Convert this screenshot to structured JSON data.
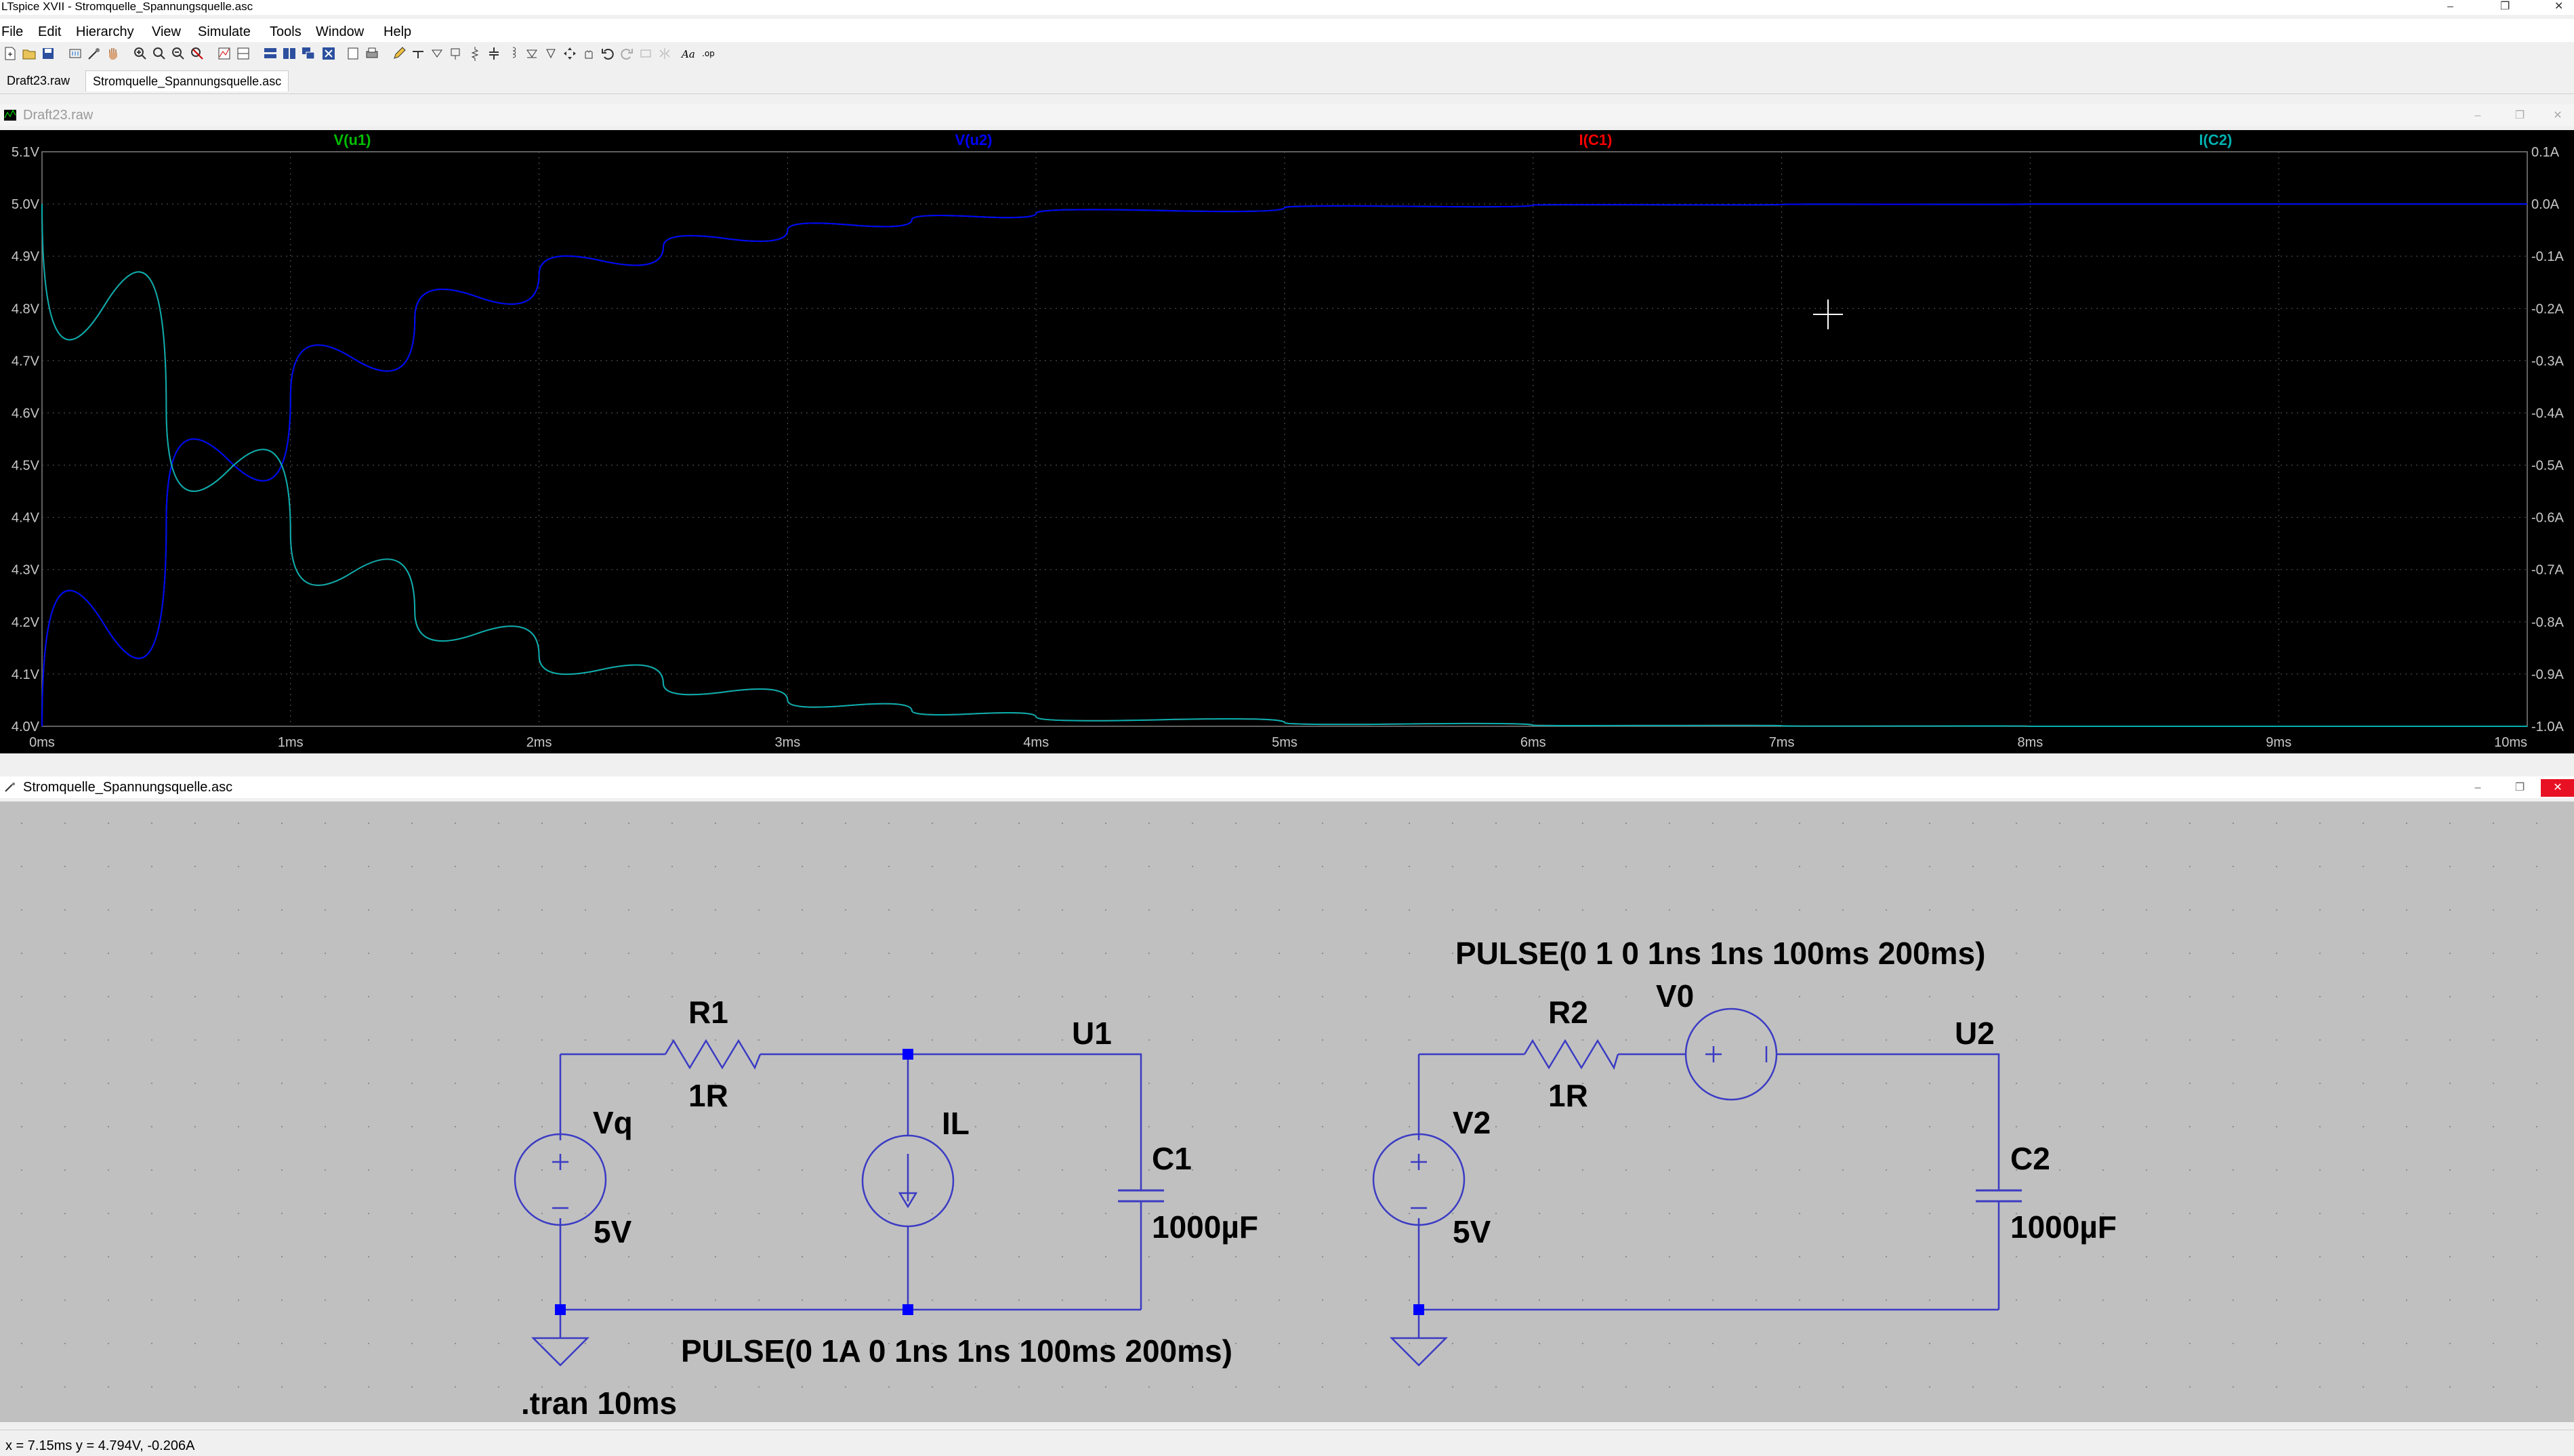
{
  "window": {
    "title": "LTspice XVII - Stromquelle_Spannungsquelle.asc",
    "controls": {
      "minimize": "–",
      "restore": "❐",
      "close": "✕"
    }
  },
  "menu": [
    "File",
    "Edit",
    "Hierarchy",
    "View",
    "Simulate",
    "Tools",
    "Window",
    "Help"
  ],
  "tabs": [
    {
      "label": "Draft23.raw",
      "active": false
    },
    {
      "label": "Stromquelle_Spannungsquelle.asc",
      "active": true
    }
  ],
  "waveform_window": {
    "title": "Draft23.raw",
    "traces": [
      {
        "name": "V(u1)",
        "color": "#00c000"
      },
      {
        "name": "V(u2)",
        "color": "#0000ff"
      },
      {
        "name": "I(C1)",
        "color": "#ff0000"
      },
      {
        "name": "I(C2)",
        "color": "#00b0b0"
      }
    ],
    "left_axis": [
      "5.1V",
      "5.0V",
      "4.9V",
      "4.8V",
      "4.7V",
      "4.6V",
      "4.5V",
      "4.4V",
      "4.3V",
      "4.2V",
      "4.1V",
      "4.0V"
    ],
    "right_axis": [
      "0.1A",
      "0.0A",
      "-0.1A",
      "-0.2A",
      "-0.3A",
      "-0.4A",
      "-0.5A",
      "-0.6A",
      "-0.7A",
      "-0.8A",
      "-0.9A",
      "-1.0A"
    ],
    "x_axis": [
      "0ms",
      "1ms",
      "2ms",
      "3ms",
      "4ms",
      "5ms",
      "6ms",
      "7ms",
      "8ms",
      "9ms",
      "10ms"
    ]
  },
  "chart_data": {
    "type": "line",
    "x": [
      0,
      0.5,
      1,
      1.5,
      2,
      2.5,
      3,
      3.5,
      4,
      5,
      6,
      7,
      8,
      9,
      10
    ],
    "xunit": "ms",
    "xlim": [
      0,
      10
    ],
    "ylim_left": [
      4.0,
      5.1
    ],
    "ylim_right": [
      -1.0,
      0.1
    ],
    "grid": true,
    "series": [
      {
        "name": "V(u1)",
        "axis": "left",
        "values": [
          4.0,
          4.39,
          4.63,
          4.78,
          4.865,
          4.918,
          4.95,
          4.97,
          4.982,
          4.993,
          4.998,
          4.999,
          5.0,
          5.0,
          5.0
        ]
      },
      {
        "name": "V(u2)",
        "axis": "left",
        "values": [
          4.0,
          4.39,
          4.63,
          4.78,
          4.865,
          4.918,
          4.95,
          4.97,
          4.982,
          4.993,
          4.998,
          4.999,
          5.0,
          5.0,
          5.0
        ]
      },
      {
        "name": "I(C1)",
        "axis": "right",
        "values": [
          -0.0,
          -0.39,
          -0.63,
          -0.78,
          -0.865,
          -0.918,
          -0.95,
          -0.97,
          -0.982,
          -0.993,
          -0.998,
          -0.999,
          -1.0,
          -1.0,
          -1.0
        ]
      },
      {
        "name": "I(C2)",
        "axis": "right",
        "values": [
          -0.0,
          -0.39,
          -0.63,
          -0.78,
          -0.865,
          -0.918,
          -0.95,
          -0.97,
          -0.982,
          -0.993,
          -0.998,
          -0.999,
          -1.0,
          -1.0,
          -1.0
        ]
      }
    ]
  },
  "schematic_window": {
    "title": "Stromquelle_Spannungsquelle.asc",
    "labels": {
      "r1": "R1",
      "r1_val": "1R",
      "u1": "U1",
      "vq": "Vq",
      "vq_val": "5V",
      "il": "IL",
      "c1": "C1",
      "c1_val": "1000µF",
      "il_pulse": "PULSE(0 1A 0 1ns 1ns 100ms 200ms)",
      "tran": ".tran 10ms",
      "v0_pulse": "PULSE(0 1 0 1ns 1ns 100ms 200ms)",
      "r2": "R2",
      "r2_val": "1R",
      "v0": "V0",
      "u2": "U2",
      "v2": "V2",
      "v2_val": "5V",
      "c2": "C2",
      "c2_val": "1000µF"
    }
  },
  "status": "x = 7.15ms    y = 4.794V, -0.206A"
}
